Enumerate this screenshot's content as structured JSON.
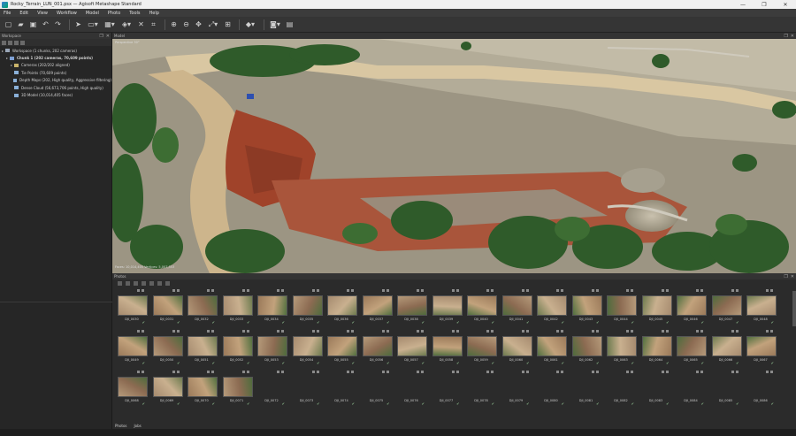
{
  "window": {
    "title": "Rocky_Terrain_LUN_001.psx — Agisoft Metashape Standard",
    "controls": [
      "—",
      "❐",
      "✕"
    ]
  },
  "menu": [
    "File",
    "Edit",
    "View",
    "Workflow",
    "Model",
    "Photo",
    "Tools",
    "Help"
  ],
  "workspace": {
    "panel_title": "Workspace",
    "items": [
      {
        "label": "Workspace (1 chunks, 202 cameras)",
        "level": 0,
        "icon": "workspace-icon",
        "color": "#9aa7b8"
      },
      {
        "label": "Chunk 1 (202 cameras, 70,609 points)",
        "level": 1,
        "icon": "chunk-icon",
        "color": "#7fa1d4",
        "bold": true
      },
      {
        "label": "Cameras (202/202 aligned)",
        "level": 2,
        "icon": "cameras-folder-icon",
        "color": "#c9b36a"
      },
      {
        "label": "Tie Points (70,609 points)",
        "level": 2,
        "icon": "tie-points-icon",
        "color": "#8ab0d8"
      },
      {
        "label": "Depth Maps (202, High quality, Aggressive filtering)",
        "level": 2,
        "icon": "depth-maps-icon",
        "color": "#8ab0d8"
      },
      {
        "label": "Dense Cloud (56,673,706 points, High quality)",
        "level": 2,
        "icon": "dense-cloud-icon",
        "color": "#8ab0d8"
      },
      {
        "label": "3D Model (10,014,405 faces)",
        "level": 2,
        "icon": "model-icon",
        "color": "#8ab0d8"
      }
    ]
  },
  "model": {
    "panel_title": "Model",
    "view_label": "Perspective 30°",
    "status_text": "Faces: 10,014,405 Vertices: 5,007,553"
  },
  "photos": {
    "panel_title": "Photos",
    "rows": [
      [
        "DJI_0030",
        "DJI_0031",
        "DJI_0032",
        "DJI_0033",
        "DJI_0034",
        "DJI_0035",
        "DJI_0036",
        "DJI_0037",
        "DJI_0038",
        "DJI_0039",
        "DJI_0040",
        "DJI_0041",
        "DJI_0042",
        "DJI_0043",
        "DJI_0044",
        "DJI_0045",
        "DJI_0046",
        "DJI_0047",
        "DJI_0048"
      ],
      [
        "DJI_0049",
        "DJI_0050",
        "DJI_0051",
        "DJI_0052",
        "DJI_0053",
        "DJI_0054",
        "DJI_0055",
        "DJI_0056",
        "DJI_0057",
        "DJI_0058",
        "DJI_0059",
        "DJI_0060",
        "DJI_0061",
        "DJI_0062",
        "DJI_0063",
        "DJI_0064",
        "DJI_0065",
        "DJI_0066",
        "DJI_0067"
      ],
      [
        "DJI_0068",
        "DJI_0069",
        "DJI_0070",
        "DJI_0071",
        "DJI_0072",
        "DJI_0073",
        "DJI_0074",
        "DJI_0075",
        "DJI_0076",
        "DJI_0077",
        "DJI_0078",
        "DJI_0079",
        "DJI_0080",
        "DJI_0081",
        "DJI_0082",
        "DJI_0083",
        "DJI_0084",
        "DJI_0085",
        "DJI_0086"
      ]
    ],
    "loaded_in_row3": 4
  },
  "bottom_tabs": [
    "Photos",
    "Jobs"
  ],
  "colors": {
    "bg": "#2b2b2b",
    "panel": "#262626",
    "toolbar": "#353535",
    "terrain_red": "#a0432a",
    "vegetation": "#2f5b2a",
    "rock": "#b9b4a6"
  }
}
